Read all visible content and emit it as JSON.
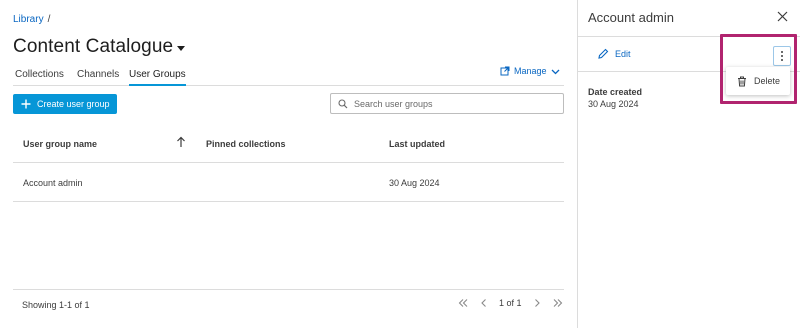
{
  "breadcrumb": {
    "link": "Library",
    "separator": "/"
  },
  "page": {
    "title": "Content Catalogue"
  },
  "tabs": [
    {
      "label": "Collections"
    },
    {
      "label": "Channels"
    },
    {
      "label": "User Groups"
    }
  ],
  "manage": {
    "label": "Manage",
    "icon": "external-link-icon"
  },
  "create": {
    "label": "Create user group",
    "icon": "plus-icon"
  },
  "search": {
    "placeholder": "Search user groups",
    "value": ""
  },
  "table": {
    "columns": [
      "User group name",
      "Pinned collections",
      "Last updated"
    ],
    "rows": [
      {
        "name": "Account admin",
        "pinned": "",
        "updated": "30 Aug 2024"
      }
    ]
  },
  "footer": {
    "showing": "Showing 1-1 of 1",
    "page": "1 of 1"
  },
  "panel": {
    "title": "Account admin",
    "edit_label": "Edit",
    "date_label": "Date created",
    "date_value": "30 Aug 2024",
    "menu": {
      "delete_label": "Delete"
    }
  },
  "colors": {
    "accent": "#0696d7",
    "link": "#0a67c2",
    "highlight": "#b1246f",
    "border": "#dcdcdc"
  }
}
